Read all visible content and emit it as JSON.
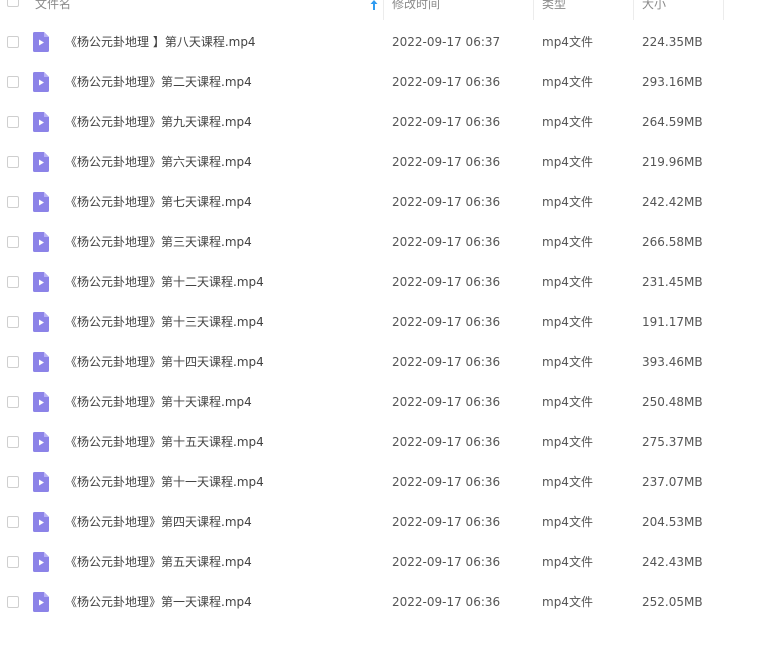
{
  "header": {
    "name_label": "文件名",
    "date_label": "修改时间",
    "type_label": "类型",
    "size_label": "大小"
  },
  "colors": {
    "file_icon": "#8c83e8",
    "sort_arrow": "#2f9bf0"
  },
  "files": [
    {
      "name": "《杨公元卦地理 】第八天课程.mp4",
      "date": "2022-09-17 06:37",
      "type": "mp4文件",
      "size": "224.35MB"
    },
    {
      "name": "《杨公元卦地理》第二天课程.mp4",
      "date": "2022-09-17 06:36",
      "type": "mp4文件",
      "size": "293.16MB"
    },
    {
      "name": "《杨公元卦地理》第九天课程.mp4",
      "date": "2022-09-17 06:36",
      "type": "mp4文件",
      "size": "264.59MB"
    },
    {
      "name": "《杨公元卦地理》第六天课程.mp4",
      "date": "2022-09-17 06:36",
      "type": "mp4文件",
      "size": "219.96MB"
    },
    {
      "name": "《杨公元卦地理》第七天课程.mp4",
      "date": "2022-09-17 06:36",
      "type": "mp4文件",
      "size": "242.42MB"
    },
    {
      "name": "《杨公元卦地理》第三天课程.mp4",
      "date": "2022-09-17 06:36",
      "type": "mp4文件",
      "size": "266.58MB"
    },
    {
      "name": "《杨公元卦地理》第十二天课程.mp4",
      "date": "2022-09-17 06:36",
      "type": "mp4文件",
      "size": "231.45MB"
    },
    {
      "name": "《杨公元卦地理》第十三天课程.mp4",
      "date": "2022-09-17 06:36",
      "type": "mp4文件",
      "size": "191.17MB"
    },
    {
      "name": "《杨公元卦地理》第十四天课程.mp4",
      "date": "2022-09-17 06:36",
      "type": "mp4文件",
      "size": "393.46MB"
    },
    {
      "name": "《杨公元卦地理》第十天课程.mp4",
      "date": "2022-09-17 06:36",
      "type": "mp4文件",
      "size": "250.48MB"
    },
    {
      "name": "《杨公元卦地理》第十五天课程.mp4",
      "date": "2022-09-17 06:36",
      "type": "mp4文件",
      "size": "275.37MB"
    },
    {
      "name": "《杨公元卦地理》第十一天课程.mp4",
      "date": "2022-09-17 06:36",
      "type": "mp4文件",
      "size": "237.07MB"
    },
    {
      "name": "《杨公元卦地理》第四天课程.mp4",
      "date": "2022-09-17 06:36",
      "type": "mp4文件",
      "size": "204.53MB"
    },
    {
      "name": "《杨公元卦地理》第五天课程.mp4",
      "date": "2022-09-17 06:36",
      "type": "mp4文件",
      "size": "242.43MB"
    },
    {
      "name": "《杨公元卦地理》第一天课程.mp4",
      "date": "2022-09-17 06:36",
      "type": "mp4文件",
      "size": "252.05MB"
    }
  ]
}
